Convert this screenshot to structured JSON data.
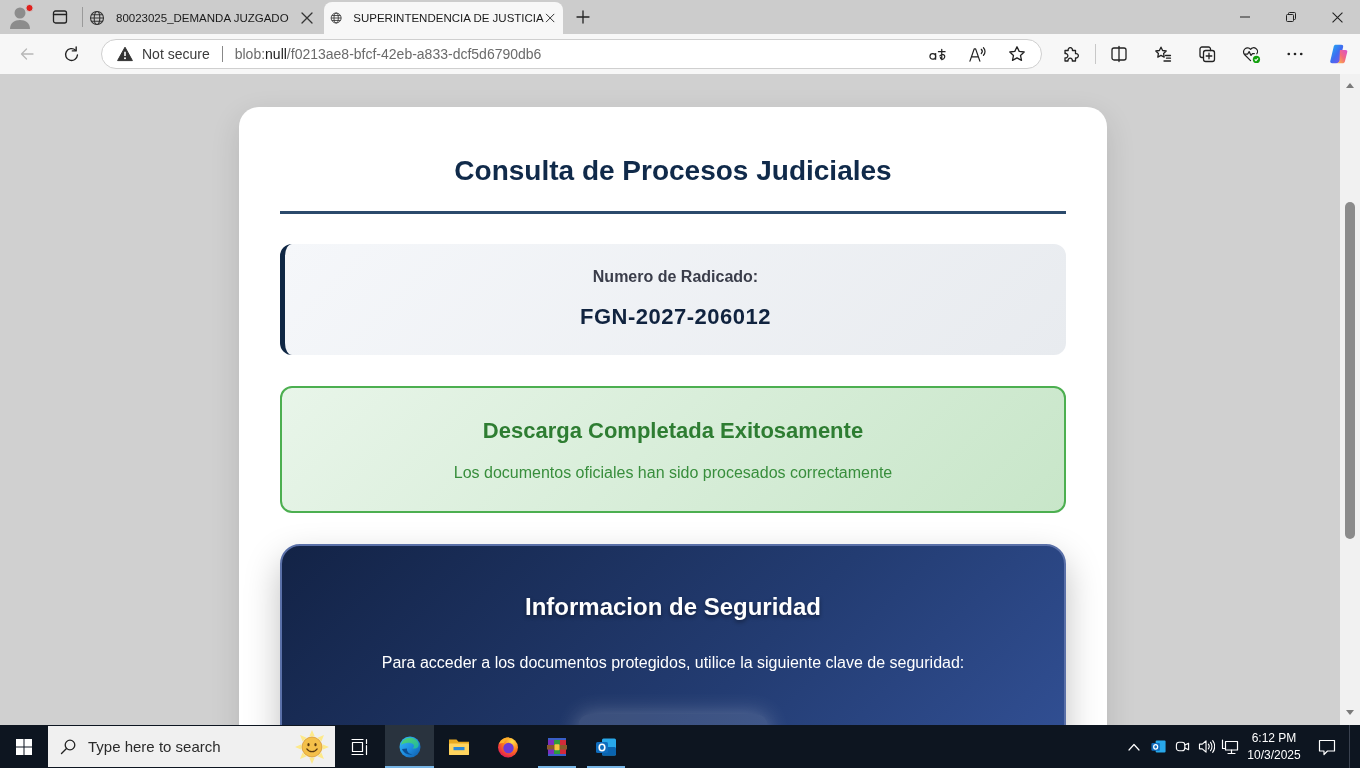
{
  "browser": {
    "tabs": [
      {
        "title": "80023025_DEMANDA JUZGADO",
        "selected": false
      },
      {
        "title": "SUPERINTENDENCIA DE JUSTICIA",
        "selected": true
      }
    ],
    "toolbar": {
      "back": {
        "disabled": true
      },
      "address_bar": {
        "security_label": "Not secure",
        "url": "blob:**null**/f0213ae8-bfcf-42eb-a833-dcf5d6790db6"
      }
    }
  },
  "page": {
    "title": "Consulta de Procesos Judiciales",
    "case_number": {
      "label": "Numero de Radicado:",
      "value": "FGN-2027-206012"
    },
    "status": {
      "title": "Descarga Completada Exitosamente",
      "message": "Los documentos oficiales han sido procesados correctamente"
    },
    "security": {
      "title": "Informacion de Seguridad",
      "message": "Para acceder a los documentos protegidos, utilice la siguiente clave de seguridad:"
    }
  },
  "taskbar": {
    "search": {
      "placeholder": "Type here to search"
    },
    "apps": [
      {
        "kind": "wave",
        "selected": true,
        "running": true
      },
      {
        "kind": "folder",
        "selected": false,
        "running": false
      },
      {
        "kind": "fox",
        "selected": false,
        "running": false
      },
      {
        "kind": "books",
        "selected": false,
        "running": true
      },
      {
        "kind": "mail",
        "selected": false,
        "running": true
      }
    ],
    "clock": {
      "time": "6:12 PM",
      "date": "10/3/2025"
    }
  }
}
